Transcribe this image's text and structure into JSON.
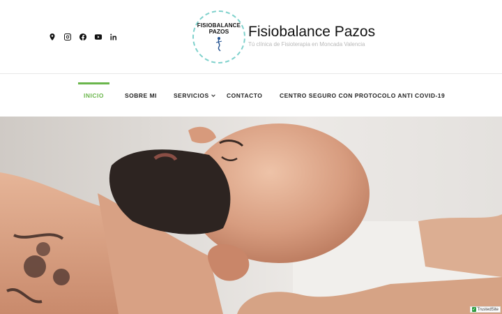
{
  "site": {
    "title": "Fisiobalance Pazos",
    "tagline": "Tú clínica de Fisioterapia en Moncada Valencia",
    "logo_line1": "FISIOBALANCE",
    "logo_line2": "PAZOS"
  },
  "social": [
    {
      "icon": "map-pin-icon"
    },
    {
      "icon": "instagram-icon"
    },
    {
      "icon": "facebook-icon"
    },
    {
      "icon": "youtube-icon"
    },
    {
      "icon": "linkedin-icon"
    }
  ],
  "nav": {
    "items": [
      {
        "label": "INICIO",
        "active": true
      },
      {
        "label": "SOBRE MI",
        "active": false
      },
      {
        "label": "SERVICIOS",
        "active": false,
        "has_dropdown": true
      },
      {
        "label": "CONTACTO",
        "active": false
      },
      {
        "label": "CENTRO SEGURO CON PROTOCOLO ANTI COVID-19",
        "active": false
      }
    ]
  },
  "badge": {
    "label": "TrustedSite"
  },
  "colors": {
    "accent": "#6ab64b",
    "logo_ring": "#7fd1cc",
    "text": "#222222",
    "tagline": "#b8b8b8"
  }
}
